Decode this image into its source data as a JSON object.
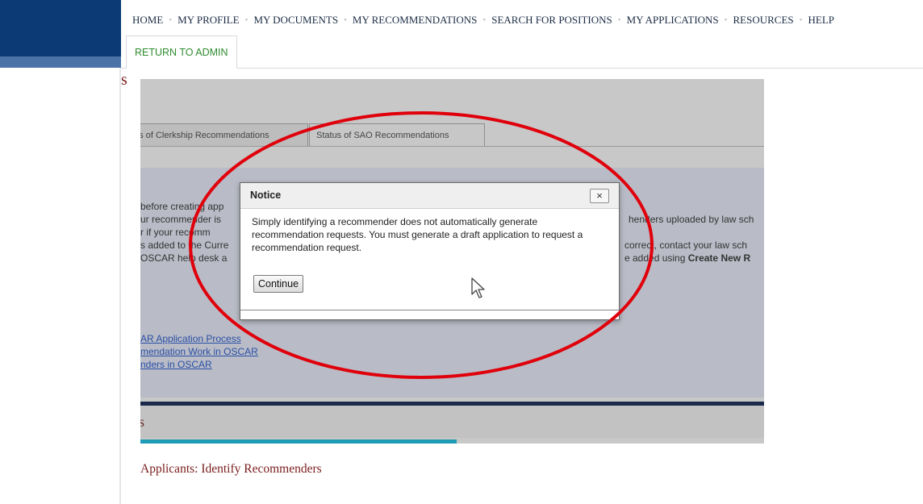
{
  "nav": {
    "items": [
      "HOME",
      "MY PROFILE",
      "MY DOCUMENTS",
      "MY RECOMMENDATIONS",
      "SEARCH FOR POSITIONS",
      "MY APPLICATIONS",
      "RESOURCES",
      "HELP"
    ],
    "admin_tab": "RETURN TO ADMIN"
  },
  "page": {
    "title_fragment": "s",
    "section_fragment": "rs",
    "bottom_link": "Applicants: Identify Recommenders"
  },
  "embedded": {
    "tabs": [
      "tus of Clerkship Recommendations",
      "Status of SAO Recommendations"
    ],
    "body_lines": [
      "before creating app",
      "ur recommender is",
      "r if your recomm",
      "s added to the Curre",
      "OSCAR help desk a"
    ],
    "right_lines": [
      "henders uploaded by law sch",
      "correct, contact your law sch",
      "e added using"
    ],
    "right_bold": "Create New R",
    "links": [
      "AR Application Process",
      "mendation Work in OSCAR",
      "nders in OSCAR"
    ]
  },
  "modal": {
    "title": "Notice",
    "close_label": "×",
    "body": "Simply identifying a recommender does not automatically generate recommendation requests.  You must generate a draft application to request a recommendation request.",
    "button": "Continue"
  },
  "icons": {
    "close": "close-icon",
    "cursor": "mouse-pointer-icon"
  },
  "colors": {
    "brand_navy": "#0c3a75",
    "admin_green": "#2e8b2e",
    "heading_maroon": "#7a1c1c",
    "annotation_red": "#e0000b",
    "progress_teal": "#1e9bb5"
  }
}
